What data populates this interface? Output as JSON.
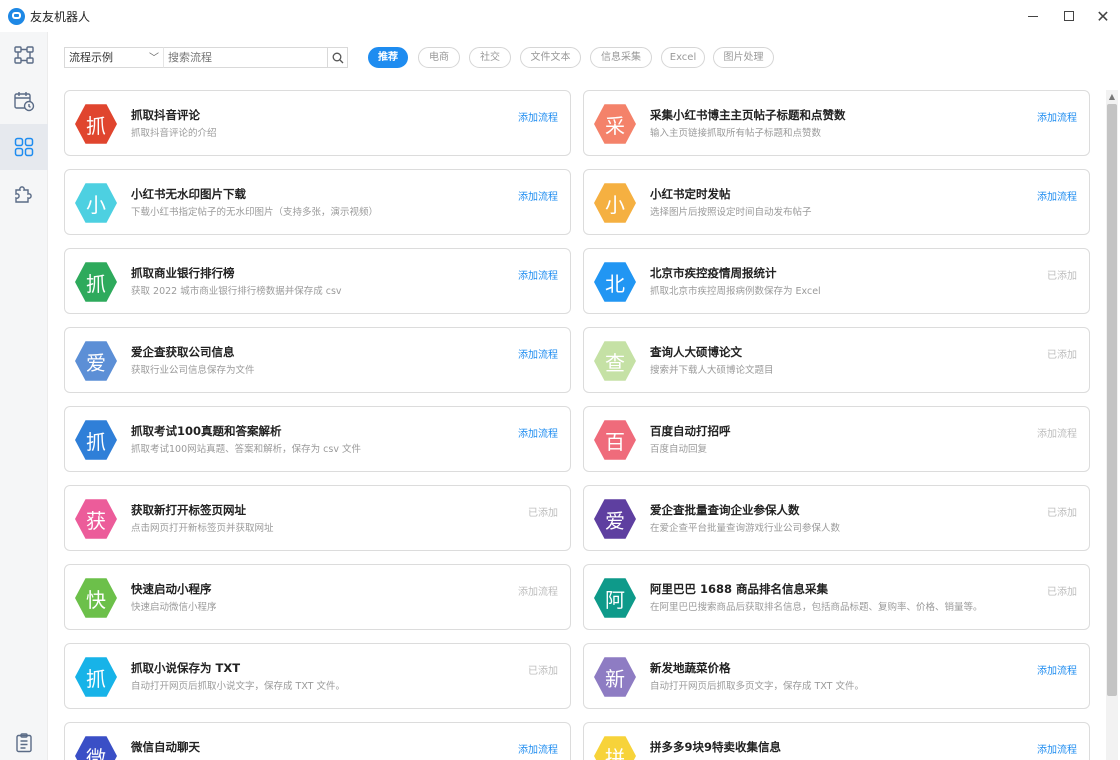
{
  "app": {
    "title": "友友机器人"
  },
  "toolbar": {
    "select_value": "流程示例",
    "search_placeholder": "搜索流程"
  },
  "tags": [
    "推荐",
    "电商",
    "社交",
    "文件文本",
    "信息采集",
    "Excel",
    "图片处理"
  ],
  "colors": {
    "accent": "#1e8cf0",
    "added": "#bdbdbd"
  },
  "cards": [
    {
      "icon": "抓",
      "color": "#e0452e",
      "title": "抓取抖音评论",
      "desc": "抓取抖音评论的介绍",
      "action": "添加流程",
      "status": "add"
    },
    {
      "icon": "采",
      "color": "#f4826a",
      "title": "采集小红书博主主页帖子标题和点赞数",
      "desc": "输入主页链接抓取所有帖子标题和点赞数",
      "action": "添加流程",
      "status": "add"
    },
    {
      "icon": "小",
      "color": "#4dd0e1",
      "title": "小红书无水印图片下载",
      "desc": "下载小红书指定帖子的无水印图片（支持多张，演示视频）",
      "action": "添加流程",
      "status": "add"
    },
    {
      "icon": "小",
      "color": "#f5b041",
      "title": "小红书定时发帖",
      "desc": "选择图片后按照设定时间自动发布帖子",
      "action": "添加流程",
      "status": "add"
    },
    {
      "icon": "抓",
      "color": "#2eaa5c",
      "title": "抓取商业银行排行榜",
      "desc": "获取 2022 城市商业银行排行榜数据并保存成 csv",
      "action": "添加流程",
      "status": "add"
    },
    {
      "icon": "北",
      "color": "#2196f3",
      "title": "北京市疾控疫情周报统计",
      "desc": "抓取北京市疾控周报病例数保存为 Excel",
      "action": "已添加",
      "status": "added"
    },
    {
      "icon": "爱",
      "color": "#5c8fd6",
      "title": "爱企查获取公司信息",
      "desc": "获取行业公司信息保存为文件",
      "action": "添加流程",
      "status": "add"
    },
    {
      "icon": "查",
      "color": "#c5e1a5",
      "title": "查询人大硕博论文",
      "desc": "搜索并下载人大硕博论文题目",
      "action": "已添加",
      "status": "added"
    },
    {
      "icon": "抓",
      "color": "#2f7fd8",
      "title": "抓取考试100真题和答案解析",
      "desc": "抓取考试100网站真题、答案和解析，保存为 csv 文件",
      "action": "添加流程",
      "status": "add"
    },
    {
      "icon": "百",
      "color": "#ef6b7b",
      "title": "百度自动打招呼",
      "desc": "百度自动回复",
      "action": "添加流程",
      "status": "added"
    },
    {
      "icon": "获",
      "color": "#ec5c9a",
      "title": "获取新打开标签页网址",
      "desc": "点击网页打开新标签页并获取网址",
      "action": "已添加",
      "status": "added"
    },
    {
      "icon": "爱",
      "color": "#5e3fa0",
      "title": "爱企查批量查询企业参保人数",
      "desc": "在爱企查平台批量查询游戏行业公司参保人数",
      "action": "已添加",
      "status": "added"
    },
    {
      "icon": "快",
      "color": "#6cc04a",
      "title": "快速启动小程序",
      "desc": "快速启动微信小程序",
      "action": "添加流程",
      "status": "added"
    },
    {
      "icon": "阿",
      "color": "#0e9a8a",
      "title": "阿里巴巴 1688 商品排名信息采集",
      "desc": "在阿里巴巴搜索商品后获取排名信息，包括商品标题、复购率、价格、销量等。",
      "action": "已添加",
      "status": "added"
    },
    {
      "icon": "抓",
      "color": "#17b3e8",
      "title": "抓取小说保存为 TXT",
      "desc": "自动打开网页后抓取小说文字，保存成 TXT 文件。",
      "action": "已添加",
      "status": "added"
    },
    {
      "icon": "新",
      "color": "#8e7cc3",
      "title": "新发地蔬菜价格",
      "desc": "自动打开网页后抓取多页文字，保存成 TXT 文件。",
      "action": "添加流程",
      "status": "add"
    },
    {
      "icon": "微",
      "color": "#3a4fc6",
      "title": "微信自动聊天",
      "desc": "",
      "action": "添加流程",
      "status": "add"
    },
    {
      "icon": "拼",
      "color": "#f7d33a",
      "title": "拼多多9块9特卖收集信息",
      "desc": "",
      "action": "添加流程",
      "status": "add"
    }
  ]
}
